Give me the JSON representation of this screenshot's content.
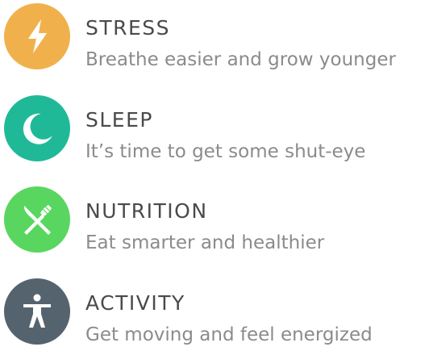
{
  "items": [
    {
      "title": "STRESS",
      "description": "Breathe easier and grow younger",
      "icon": "lightning-bolt-icon",
      "color": "#F0B14D"
    },
    {
      "title": "SLEEP",
      "description": "It’s time to get some shut-eye",
      "icon": "crescent-moon-icon",
      "color": "#20B998"
    },
    {
      "title": "NUTRITION",
      "description": "Eat smarter and healthier",
      "icon": "fork-knife-icon",
      "color": "#59D65F"
    },
    {
      "title": "ACTIVITY",
      "description": "Get moving and feel energized",
      "icon": "person-figure-icon",
      "color": "#55636F"
    }
  ]
}
